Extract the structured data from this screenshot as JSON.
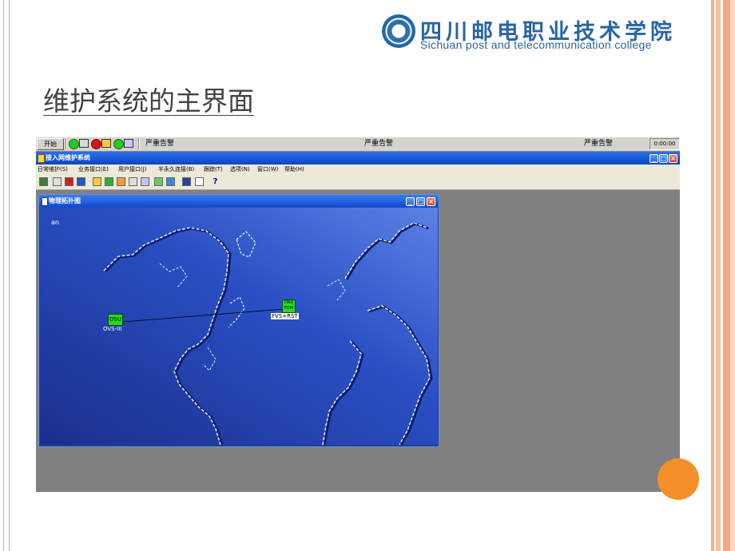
{
  "header": {
    "logo_cn": "四川邮电职业技术学院",
    "logo_en": "Sichuan  post and telecommunication college"
  },
  "slide": {
    "title": "维护系统的主界面"
  },
  "taskbar": {
    "start_label": "开始",
    "alarm_label_1": "严重告警",
    "alarm_label_2": "严重告警",
    "alarm_label_3": "严重告警",
    "clock": "0:00:00"
  },
  "app": {
    "title": "接入网维护系统",
    "menu": [
      "日常维护(S)",
      "业务接口(E)",
      "用户接口(J)",
      "半永久连接(B)",
      "跟踪(T)",
      "选项(N)",
      "窗口(W)",
      "帮助(H)"
    ]
  },
  "child_window": {
    "title": "物理拓扑图",
    "map_tag": "an",
    "nodes": [
      {
        "label": "OSU",
        "caption": "OVS-III"
      },
      {
        "label": "ONU FDM",
        "caption": "FVS+RST"
      }
    ]
  },
  "colors": {
    "accent": "#2864a6",
    "title_blue": "#0a47c8",
    "map_blue": "#1e3fa3",
    "node_green": "#22dd22",
    "orange": "#f4902a"
  }
}
